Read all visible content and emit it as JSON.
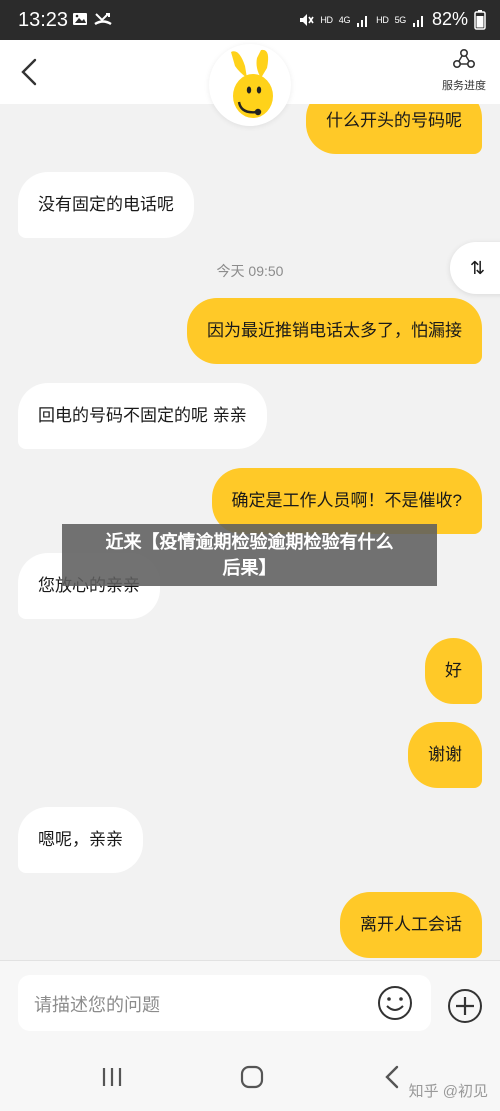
{
  "status_bar": {
    "time": "13:23",
    "left_icons": [
      "image-icon",
      "missed-call-icon"
    ],
    "hd1": "HD",
    "hd1_net": "4G",
    "hd2": "HD",
    "hd2_net": "5G",
    "battery": "82%"
  },
  "header": {
    "back_icon": "chevron-left-icon",
    "avatar": "yellow-rabbit-mascot",
    "service_progress_label": "服务进度"
  },
  "chat": {
    "timestamp": "今天 09:50",
    "scroll_button_label": "⇅",
    "messages": [
      {
        "side": "out",
        "text": "什么开头的号码呢"
      },
      {
        "side": "in",
        "text": "没有固定的电话呢"
      },
      {
        "side": "out",
        "text": "因为最近推销电话太多了，怕漏接"
      },
      {
        "side": "in",
        "text": "回电的号码不固定的呢  亲亲"
      },
      {
        "side": "out",
        "text": "确定是工作人员啊！不是催收?"
      },
      {
        "side": "in",
        "text": "您放心的亲亲"
      },
      {
        "side": "out",
        "text": "好"
      },
      {
        "side": "out",
        "text": "谢谢"
      },
      {
        "side": "in",
        "text": "嗯呢，亲亲"
      },
      {
        "side": "out",
        "text": "离开人工会话"
      }
    ]
  },
  "overlay": {
    "line1": "近来【疫情逾期检验逾期检验有什么",
    "line2": "后果】"
  },
  "input": {
    "placeholder": "请描述您的问题"
  },
  "watermark": "知乎 @初见",
  "colors": {
    "accent_yellow": "#ffc928",
    "background": "#f2f2f2",
    "status_bar": "#2b2b2b"
  }
}
